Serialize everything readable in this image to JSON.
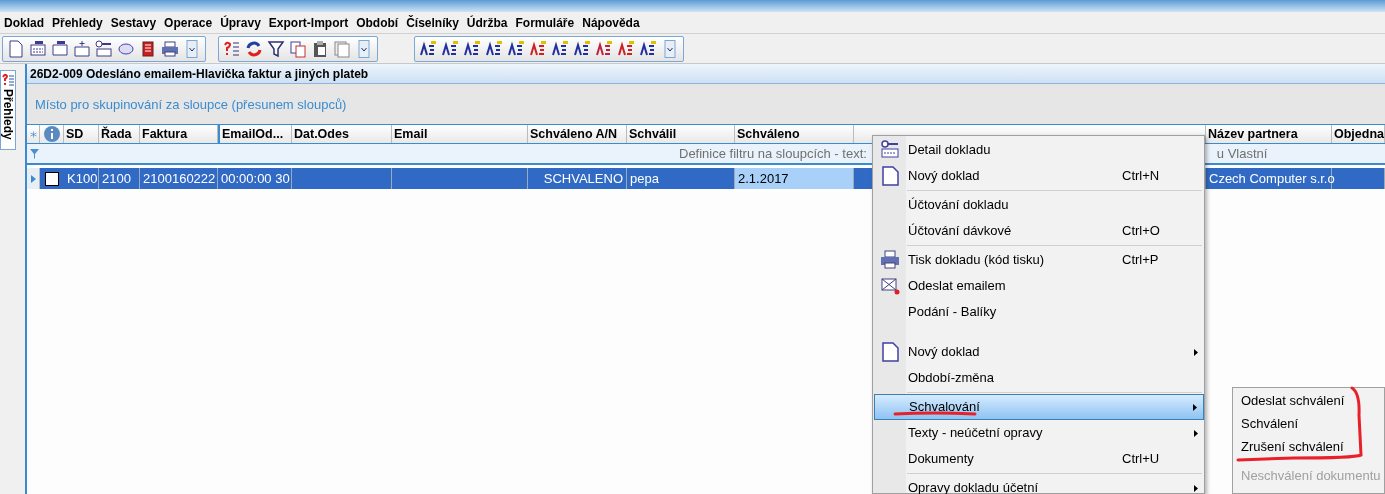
{
  "menu_bar": [
    {
      "label": "Doklad"
    },
    {
      "label": "Přehledy"
    },
    {
      "label": "Sestavy"
    },
    {
      "label": "Operace"
    },
    {
      "label": "Úpravy"
    },
    {
      "label": "Export-Import"
    },
    {
      "label": "Období"
    },
    {
      "label": "Číselníky"
    },
    {
      "label": "Údržba"
    },
    {
      "label": "Formuláře"
    },
    {
      "label": "Nápověda"
    }
  ],
  "side_tab": {
    "label": "Přehledy"
  },
  "panel": {
    "title": "26D2-009 Odesláno emailem-Hlavička faktur a jiných plateb",
    "group_hint": "Místo pro skupinování za sloupce (přesunem sloupců)",
    "columns": [
      {
        "label": "SD"
      },
      {
        "label": "Řada"
      },
      {
        "label": "Faktura"
      },
      {
        "label": "EmailOd..."
      },
      {
        "label": "Dat.Odes"
      },
      {
        "label": "Email"
      },
      {
        "label": "Schváleno A/N"
      },
      {
        "label": "Schválil"
      },
      {
        "label": "Schváleno"
      },
      {
        "label": "Název partnera"
      },
      {
        "label": "Objedna"
      }
    ],
    "filter_text": "Definice filtru na sloupcích - text:",
    "filter_text_right": "u Vlastní",
    "rows": [
      {
        "selected": true,
        "checked": false,
        "cells": [
          {
            "text": "K100",
            "focused": false
          },
          {
            "text": "2100",
            "focused": false
          },
          {
            "text": "2100160222",
            "focused": false
          },
          {
            "text": "00:00:00 30",
            "focused": false
          },
          {
            "focused": false
          },
          {
            "focused": false
          },
          {
            "text": "SCHVALENO",
            "focused": false
          },
          {
            "text": "pepa",
            "focused": false
          },
          {
            "text": "2.1.2017",
            "focused": true
          },
          {
            "text": "Czech Computer s.r.o",
            "focused": false
          },
          {
            "focused": false
          }
        ]
      }
    ]
  },
  "context_menu": {
    "items": [
      {
        "kind": "item",
        "label": "Detail dokladu",
        "submenu": false,
        "highlighted": false
      },
      {
        "kind": "item",
        "label": "Nový doklad",
        "shortcut": "Ctrl+N",
        "submenu": false,
        "highlighted": false
      },
      {
        "kind": "separator"
      },
      {
        "kind": "item",
        "label": "Účtování dokladu",
        "submenu": false,
        "highlighted": false
      },
      {
        "kind": "item",
        "label": "Účtování dávkové",
        "shortcut": "Ctrl+O",
        "submenu": false,
        "highlighted": false
      },
      {
        "kind": "separator"
      },
      {
        "kind": "item",
        "label": "Tisk dokladu (kód tisku)",
        "shortcut": "Ctrl+P",
        "submenu": false,
        "highlighted": false
      },
      {
        "kind": "item",
        "label": "Odeslat emailem",
        "submenu": false,
        "highlighted": false
      },
      {
        "kind": "item",
        "label": "Podání - Balíky",
        "submenu": false,
        "highlighted": false
      },
      {
        "kind": "gap"
      },
      {
        "kind": "item",
        "label": "Nový doklad",
        "submenu": true,
        "highlighted": false
      },
      {
        "kind": "item",
        "label": "Období-změna",
        "submenu": false,
        "highlighted": false
      },
      {
        "kind": "separator"
      },
      {
        "kind": "item",
        "label": "Schvalování",
        "submenu": true,
        "highlighted": true
      },
      {
        "kind": "item",
        "label": "Texty - neúčetní opravy",
        "submenu": true,
        "highlighted": false
      },
      {
        "kind": "item",
        "label": "Dokumenty",
        "shortcut": "Ctrl+U",
        "submenu": false,
        "highlighted": false
      },
      {
        "kind": "separator"
      },
      {
        "kind": "item",
        "label": "Opravy dokladu účetní",
        "submenu": true,
        "highlighted": false
      }
    ]
  },
  "submenu": {
    "items": [
      {
        "label": "Odeslat schválení",
        "disabled": false
      },
      {
        "label": "Schválení",
        "disabled": false
      },
      {
        "label": "Zrušení schválení",
        "disabled": false
      },
      {
        "label": "Neschválení dokumentu",
        "disabled": true
      }
    ]
  }
}
